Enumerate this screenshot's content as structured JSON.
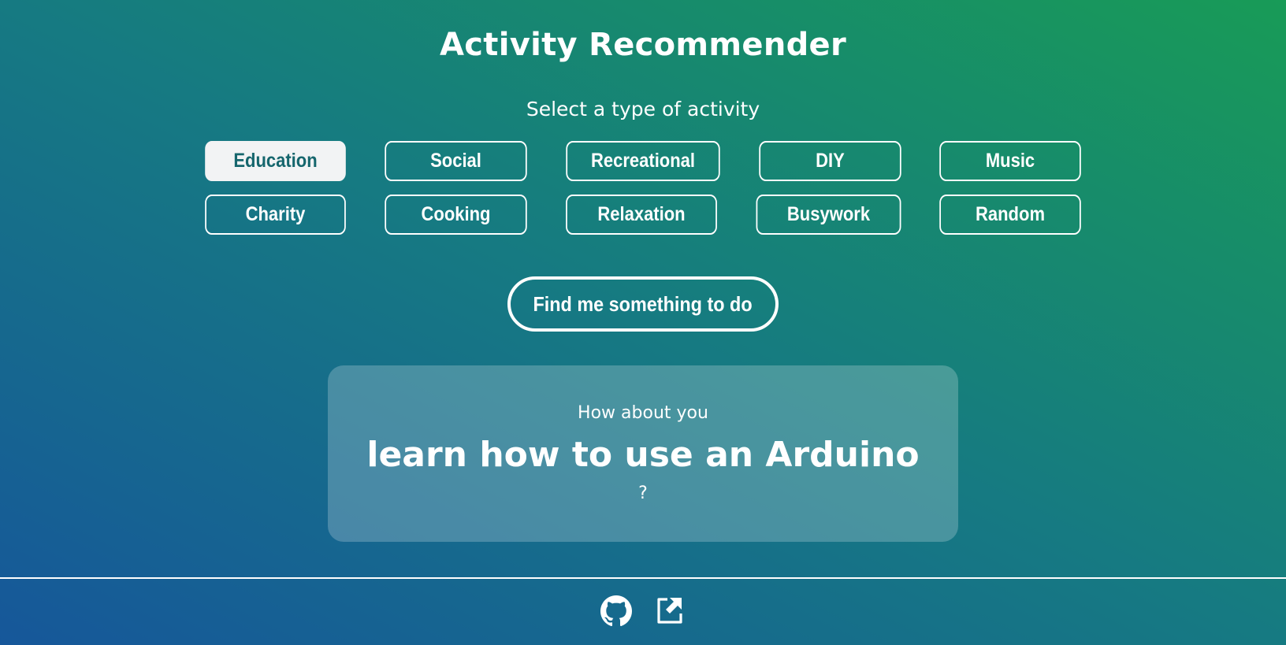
{
  "header": {
    "title": "Activity Recommender",
    "subtitle": "Select a type of activity"
  },
  "activity_types": [
    {
      "label": "Education",
      "selected": true
    },
    {
      "label": "Social",
      "selected": false
    },
    {
      "label": "Recreational",
      "selected": false
    },
    {
      "label": "DIY",
      "selected": false
    },
    {
      "label": "Music",
      "selected": false
    },
    {
      "label": "Charity",
      "selected": false
    },
    {
      "label": "Cooking",
      "selected": false
    },
    {
      "label": "Relaxation",
      "selected": false
    },
    {
      "label": "Busywork",
      "selected": false
    },
    {
      "label": "Random",
      "selected": false
    }
  ],
  "find_button": {
    "label": "Find me something to do"
  },
  "result": {
    "lead": "How about you",
    "activity": "learn how to use an Arduino",
    "tail": "?"
  },
  "footer": {
    "icons": [
      "github-icon",
      "external-link-icon"
    ]
  },
  "colors": {
    "background_start": "#16579a",
    "background_end": "#189b57",
    "selected_button_bg": "#f2f3f4",
    "selected_button_text": "#16666d",
    "text": "#ffffff"
  }
}
